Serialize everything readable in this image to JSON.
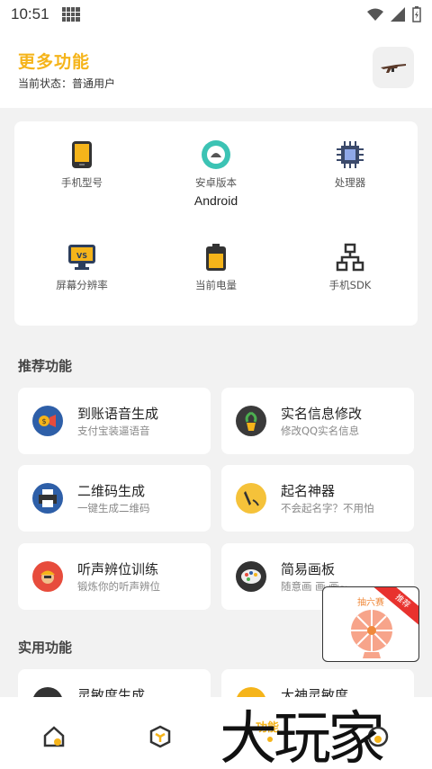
{
  "statusbar": {
    "time": "10:51"
  },
  "header": {
    "title": "更多功能",
    "status": "当前状态：普通用户"
  },
  "info": [
    {
      "label": "手机型号",
      "value": ""
    },
    {
      "label": "安卓版本",
      "value": "Android"
    },
    {
      "label": "处理器",
      "value": ""
    },
    {
      "label": "屏幕分辨率",
      "value": ""
    },
    {
      "label": "当前电量",
      "value": ""
    },
    {
      "label": "手机SDK",
      "value": ""
    }
  ],
  "sections": {
    "recommend": "推荐功能",
    "practical": "实用功能"
  },
  "features": [
    {
      "title": "到账语音生成",
      "subtitle": "支付宝装逼语音"
    },
    {
      "title": "实名信息修改",
      "subtitle": "修改QQ实名信息"
    },
    {
      "title": "二维码生成",
      "subtitle": "一键生成二维码"
    },
    {
      "title": "起名神器",
      "subtitle": "不会起名字？不用怕"
    },
    {
      "title": "听声辨位训练",
      "subtitle": "锻炼你的听声辨位"
    },
    {
      "title": "简易画板",
      "subtitle": "随意画 画 画~"
    },
    {
      "title": "灵敏度生成",
      "subtitle": ""
    },
    {
      "title": "大神灵敏度",
      "subtitle": ""
    }
  ],
  "promo": {
    "title": "抽六赛",
    "ribbon": "推荐"
  },
  "bottombar": {
    "active_label": "功能"
  },
  "watermark": "大玩家",
  "colors": {
    "accent": "#f5b41a",
    "background": "#f2f2f2"
  }
}
